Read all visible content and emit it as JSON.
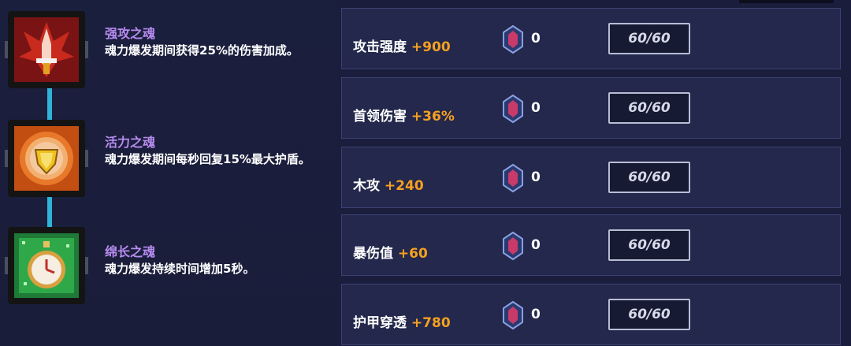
{
  "souls": [
    {
      "name": "强攻之魂",
      "desc": "魂力爆发期间获得25%的伤害加成。",
      "icon": "flame-sword-icon",
      "color": "#d63a2a"
    },
    {
      "name": "活力之魂",
      "desc": "魂力爆发期间每秒回复15%最大护盾。",
      "icon": "shield-heart-icon",
      "color": "#e8782a"
    },
    {
      "name": "绵长之魂",
      "desc": "魂力爆发持续时间增加5秒。",
      "icon": "stopwatch-icon",
      "color": "#2fa84a"
    }
  ],
  "stats": [
    {
      "label": "攻击强度",
      "bonus": "+900",
      "count": "0",
      "capacity": "60/60"
    },
    {
      "label": "首领伤害",
      "bonus": "+36%",
      "count": "0",
      "capacity": "60/60"
    },
    {
      "label": "木攻",
      "bonus": "+240",
      "count": "0",
      "capacity": "60/60"
    },
    {
      "label": "暴伤值",
      "bonus": "+60",
      "count": "0",
      "capacity": "60/60"
    },
    {
      "label": "护甲穿透",
      "bonus": "+780",
      "count": "0",
      "capacity": "60/60"
    }
  ],
  "colors": {
    "bonus": "#f5a020",
    "soul_name": "#b78cf0",
    "connector": "#2fb3d6"
  }
}
